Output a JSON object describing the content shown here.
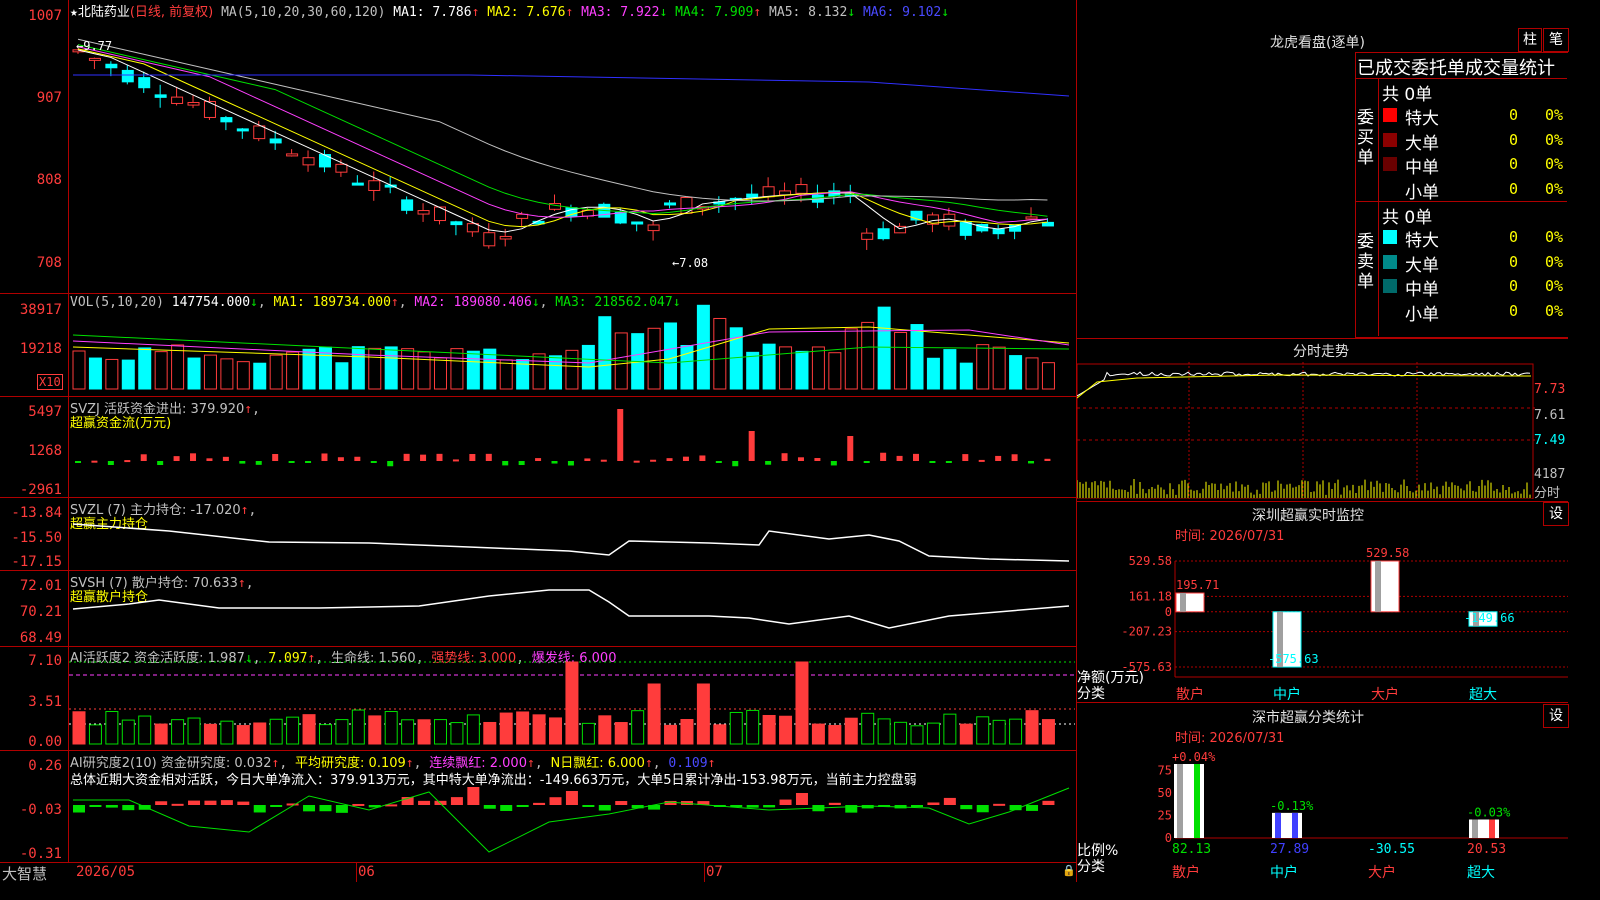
{
  "colors": {
    "up": "#ff3c3c",
    "down": "#00ffff",
    "bg": "#000000",
    "grid": "#b00000",
    "ma1": "#ffffff",
    "ma2": "#ffff00",
    "ma3": "#ff40ff",
    "ma4": "#00e000",
    "ma5": "#c0c0c0",
    "ma6": "#3030ff"
  },
  "header": {
    "star": "★",
    "stock": "北陆药业",
    "period": "(日线, 前复权)",
    "ma_params": "MA(5,10,20,30,60,120)",
    "ma1": "MA1: 7.786",
    "ma2": "MA2: 7.676",
    "ma3": "MA3: 7.922",
    "ma4": "MA4: 7.909",
    "ma5": "MA5: 8.132",
    "ma6": "MA6: 9.102",
    "arrow_up": "↑",
    "arrow_down": "↓"
  },
  "price_axis": [
    "1007",
    "907",
    "808",
    "708"
  ],
  "price_annotations": {
    "high": "9.77",
    "low": "7.08"
  },
  "vol": {
    "label": "VOL(5,10,20)",
    "val": "147754.000",
    "ma1": "MA1: 189734.000",
    "ma2": "MA2: 189080.406",
    "ma3": "MA3: 218562.047",
    "axis": [
      "38917",
      "19218"
    ],
    "mult": "X10"
  },
  "svzj": {
    "label": "SVZJ  活跃资金进出: 379.920",
    "sub": "超赢资金流(万元)",
    "axis": [
      "5497",
      "1268",
      "-2961"
    ]
  },
  "svzl": {
    "label": "SVZL (7) 主力持仓: -17.020",
    "sub": "超赢主力持仓",
    "axis": [
      "-13.84",
      "-15.50",
      "-17.15"
    ]
  },
  "svsh": {
    "label": "SVSH (7) 散户持仓: 70.633",
    "sub": "超赢散户持仓",
    "axis": [
      "72.01",
      "70.21",
      "68.49"
    ]
  },
  "ai1": {
    "label": "AI活跃度2 资金活跃度: 1.987",
    "v2": "7.097",
    "life": "生命线: 1.560",
    "strong": "强势线: 3.000",
    "burst": "爆发线: 6.000",
    "axis": [
      "7.10",
      "3.51",
      "0.00"
    ]
  },
  "ai2": {
    "label": "AI研究度2(10) 资金研究度: 0.032",
    "avg": "平均研究度: 0.109",
    "red1": "连续飘红: 2.000",
    "red2": "N日飘红: 6.000",
    "v5": "0.109",
    "summary": "总体近期大资金相对活跃，今日大单净流入：379.913万元，其中特大单净流出：-149.663万元，大单5日累计净出-153.98万元，当前主力控盘弱",
    "axis": [
      "0.26",
      "-0.03",
      "-0.31"
    ]
  },
  "bottom": {
    "brand": "大智慧",
    "dates": [
      "2026/05",
      "06",
      "07"
    ]
  },
  "lhkp": {
    "title": "龙虎看盘(逐单)",
    "btn1": "柱",
    "btn2": "笔",
    "sub": "已成交委托单成交量统计",
    "buy": {
      "side": "委买单",
      "total": "共 0单",
      "rows": [
        {
          "name": "特大",
          "v": "0",
          "p": "0%",
          "c": "#ff0000"
        },
        {
          "name": "大单",
          "v": "0",
          "p": "0%",
          "c": "#8b0000"
        },
        {
          "name": "中单",
          "v": "0",
          "p": "0%",
          "c": "#6a0000"
        },
        {
          "name": "小单",
          "v": "0",
          "p": "0%",
          "c": "#000000"
        }
      ]
    },
    "sell": {
      "side": "委卖单",
      "total": "共 0单",
      "rows": [
        {
          "name": "特大",
          "v": "0",
          "p": "0%",
          "c": "#00ffff"
        },
        {
          "name": "大单",
          "v": "0",
          "p": "0%",
          "c": "#008b8b"
        },
        {
          "name": "中单",
          "v": "0",
          "p": "0%",
          "c": "#006a6a"
        },
        {
          "name": "小单",
          "v": "0",
          "p": "0%",
          "c": "#000000"
        }
      ]
    }
  },
  "fenshi": {
    "title": "分时走势",
    "axis": [
      "7.73",
      "7.61",
      "7.49"
    ],
    "vol": "4187",
    "volname": "分时"
  },
  "szmon": {
    "title": "深圳超赢实时监控",
    "btn": "设",
    "time": "时间: 2026/07/31",
    "unit": "净额(万元)",
    "cat": "分类",
    "axis": [
      "529.58",
      "161.18",
      "0",
      "-207.23",
      "-575.63"
    ],
    "chart_data": {
      "type": "bar",
      "categories": [
        "散户",
        "中户",
        "大户",
        "超大"
      ],
      "values": [
        195.71,
        -575.63,
        529.58,
        -149.66
      ],
      "ylim": [
        -575.63,
        529.58
      ]
    }
  },
  "szcls": {
    "title": "深市超赢分类统计",
    "btn": "设",
    "time": "时间: 2026/07/31",
    "unit": "比例%",
    "cat": "分类",
    "axis": [
      "75",
      "50",
      "25",
      "0"
    ],
    "chart_data": {
      "type": "bar",
      "categories": [
        "散户",
        "中户",
        "大户",
        "超大"
      ],
      "values": [
        82.13,
        27.89,
        -30.55,
        20.53
      ],
      "tops": [
        "+0.04%",
        "-0.13%",
        "",
        "-0.03%"
      ],
      "ylim": [
        0,
        82.13
      ]
    }
  }
}
